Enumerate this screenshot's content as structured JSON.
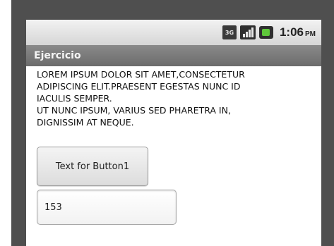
{
  "status_bar": {
    "network_badge": "3G",
    "time": "1:06",
    "ampm": "PM",
    "icons": [
      "3g-icon",
      "signal-icon",
      "battery-icon"
    ]
  },
  "app": {
    "title": "Ejercicio"
  },
  "main": {
    "text_lines": [
      "LOREM IPSUM DOLOR SIT AMET,CONSECTETUR",
      "ADIPISCING ELIT.PRAESENT EGESTAS NUNC ID",
      "IACULIS SEMPER.",
      "UT NUNC IPSUM, VARIUS SED PHARETRA IN,",
      "DIGNISSIM AT NEQUE."
    ],
    "button_label": "Text for Button1",
    "field_value": "153"
  },
  "colors": {
    "status_bar": "#dcdcdc",
    "title_bar": "#777777",
    "battery": "#5fc83a"
  }
}
